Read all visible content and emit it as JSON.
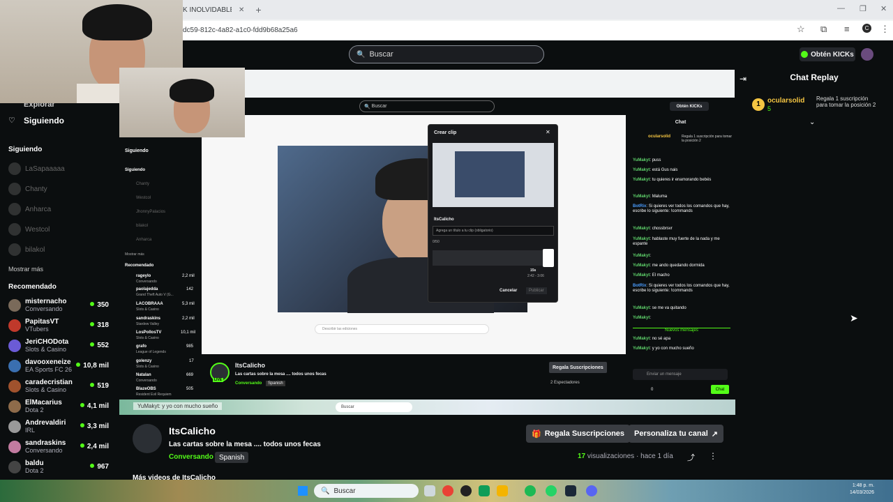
{
  "browser": {
    "tab_title": "K INOLVIDABLE",
    "url": "dc59-812c-4a82-a1c0-fdd9b68a25a6"
  },
  "topbar": {
    "search_placeholder": "Buscar",
    "kicks_label": "Obtén KICKs"
  },
  "sidebar": {
    "explore_label": "Explorar",
    "following_label": "Siguiendo",
    "following_header": "Siguiendo",
    "offline": [
      "LaSapaaaaa",
      "Chanty",
      "Anharca",
      "Westcol",
      "bilakol"
    ],
    "show_more": "Mostrar más",
    "recommended_header": "Recomendado",
    "recommended": [
      {
        "name": "misternacho",
        "category": "Conversando",
        "viewers": "350"
      },
      {
        "name": "PapitasVT",
        "category": "VTubers",
        "viewers": "318"
      },
      {
        "name": "JeriCHODota",
        "category": "Slots & Casino",
        "viewers": "552"
      },
      {
        "name": "davooxeneize",
        "category": "EA Sports FC 26",
        "viewers": "10,8 mil"
      },
      {
        "name": "caradecristian",
        "category": "Slots & Casino",
        "viewers": "519"
      },
      {
        "name": "ElMacarius",
        "category": "Dota 2",
        "viewers": "4,1 mil"
      },
      {
        "name": "Andrevaldiri",
        "category": "IRL",
        "viewers": "3,3 mil"
      },
      {
        "name": "sandraskins",
        "category": "Conversando",
        "viewers": "2,4 mil"
      },
      {
        "name": "baldu",
        "category": "Dota 2",
        "viewers": "967"
      }
    ]
  },
  "inner": {
    "search": "Buscar",
    "kicks": "Obtén KICKs",
    "sidebar_following": "Siguiendo",
    "sidebar_following_header": "Siguiendo",
    "offline": [
      "Chanty",
      "Westcol",
      "JhonnyPalacios",
      "bilakol",
      "Anharca"
    ],
    "show_more": "Mostrar más",
    "recommended_header": "Recomendado",
    "recommended": [
      {
        "name": "rageylo",
        "category": "Conversando",
        "viewers": "2,2 mil"
      },
      {
        "name": "paolajedda",
        "category": "Grand Theft Auto V (G...",
        "viewers": "142"
      },
      {
        "name": "LACOBRAAA",
        "category": "Slots & Casino",
        "viewers": "5,3 mil"
      },
      {
        "name": "sandraskins",
        "category": "Stardew Valley",
        "viewers": "2,2 mil"
      },
      {
        "name": "LosPollosTV",
        "category": "Slots & Casino",
        "viewers": "10,1 mil"
      },
      {
        "name": "grafo",
        "category": "League of Legends",
        "viewers": "985"
      },
      {
        "name": "golenzy",
        "category": "Slots & Casino",
        "viewers": "17"
      },
      {
        "name": "Natalan",
        "category": "Conversando",
        "viewers": "669"
      },
      {
        "name": "BlazeOBS",
        "category": "Resident Evil Requiem",
        "viewers": "505"
      }
    ],
    "clip_modal": {
      "title": "Crear clip",
      "user": "ItsCalicho",
      "title_placeholder": "Agrega un título a tu clip (obligatorio)",
      "counter": "0/50",
      "duration": "15s",
      "range": "2:42 - 3:06",
      "cancel": "Cancelar",
      "publish": "Publicar"
    },
    "chat_title": "Chat",
    "pinned_user": "ocularsolid",
    "pinned_text": "Regala 1 suscripción para tomar la posición 2",
    "messages": [
      {
        "user": "YuMakyt",
        "text": "puss"
      },
      {
        "user": "YuMakyt",
        "text": "está Gus nais"
      },
      {
        "user": "YuMakyt",
        "text": "tu quieres ir enamorando bebés"
      },
      {
        "user": "YuMakyt",
        "text": "Maluma"
      },
      {
        "user": "BotRix",
        "text": "Si quieres ver todos los comandos que hay, escribe lo siguiente: !commands"
      },
      {
        "user": "YuMakyt",
        "text": "chossbrsvr"
      },
      {
        "user": "YuMakyt",
        "text": "hablaste muy fuerte de la nada y me espante"
      },
      {
        "user": "YuMakyt",
        "text": ""
      },
      {
        "user": "YuMakyt",
        "text": "me ando quedando dormida"
      },
      {
        "user": "YuMakyt",
        "text": "El macho"
      },
      {
        "user": "BotRix",
        "text": "Si quieres ver todos los comandos que hay, escribe lo siguiente: !commands"
      },
      {
        "user": "YuMakyt",
        "text": "se me va quitando"
      },
      {
        "user": "YuMakyt",
        "text": ""
      }
    ],
    "new_messages": "Nuevos mensajes",
    "messages_after": [
      {
        "user": "YuMakyt",
        "text": "no sé apa"
      },
      {
        "user": "YuMakyt",
        "text": "y yo con mucho sueño"
      }
    ],
    "chat_input": "Enviar un mensaje",
    "chat_button": "Chat",
    "chat_count": "0",
    "streamer": "ItsCalicho",
    "stream_title": "Las cartas sobre la mesa .... todos unos fecas",
    "category": "Conversando",
    "language": "Spanish",
    "gift_btn": "Regala Suscripciones",
    "spectators": "2 Espectadores",
    "live_badge": "LIVE",
    "ticker": "YuMakyt: y yo con mucho sueño",
    "taskbar_search": "Buscar",
    "describe_placeholder": "Describir las ediciones"
  },
  "chat": {
    "title": "Chat Replay",
    "pinned_user": "ocularsolid",
    "pinned_count": "5",
    "pinned_text": "Regala 1 suscripción para tomar la posición 2"
  },
  "stream": {
    "streamer": "ItsCalicho",
    "title": "Las cartas sobre la mesa .... todos unos fecas",
    "category": "Conversando",
    "language": "Spanish",
    "gift_btn": "Regala Suscripciones",
    "customize_btn": "Personaliza tu canal",
    "views_count": "17",
    "views_label": "visualizaciones",
    "ago": "hace 1 día",
    "more_videos": "Más videos de ItsCalicho"
  },
  "taskbar": {
    "search": "Buscar",
    "time": "1:48 p. m.",
    "date": "14/03/2026"
  },
  "colors": {
    "accent": "#53fc18",
    "bg": "#0b0e0f"
  }
}
